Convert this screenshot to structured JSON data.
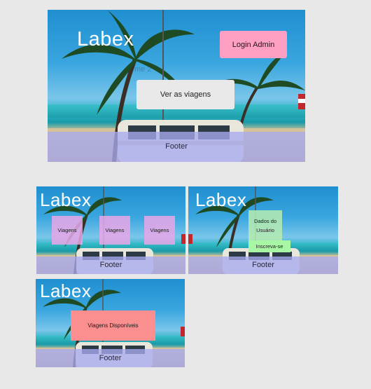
{
  "frame1": {
    "logo": "Labex",
    "ghost": "me 2",
    "login_button": "Login Admin",
    "view_button": "Ver as viagens",
    "footer": "Footer"
  },
  "frame2": {
    "logo": "Labex",
    "trip_cards": [
      "Viagens",
      "Viagens",
      "Viagens"
    ],
    "footer": "Footer"
  },
  "frame3": {
    "logo": "Labex",
    "user_data": "Dados do Usuário",
    "subscribe_button": "Inscreva-se",
    "footer": "Footer"
  },
  "frame4": {
    "logo": "Labex",
    "available_trips": "Viagens Disponíveis",
    "footer": "Footer"
  },
  "colors": {
    "pink_button": "#ff9fc4",
    "card_pink": "#e9a6e8",
    "card_green": "#b6ecb0",
    "subscribe_green": "#a7f7a4",
    "salmon": "#fb8e8e",
    "footer": "#a8aaf0"
  }
}
